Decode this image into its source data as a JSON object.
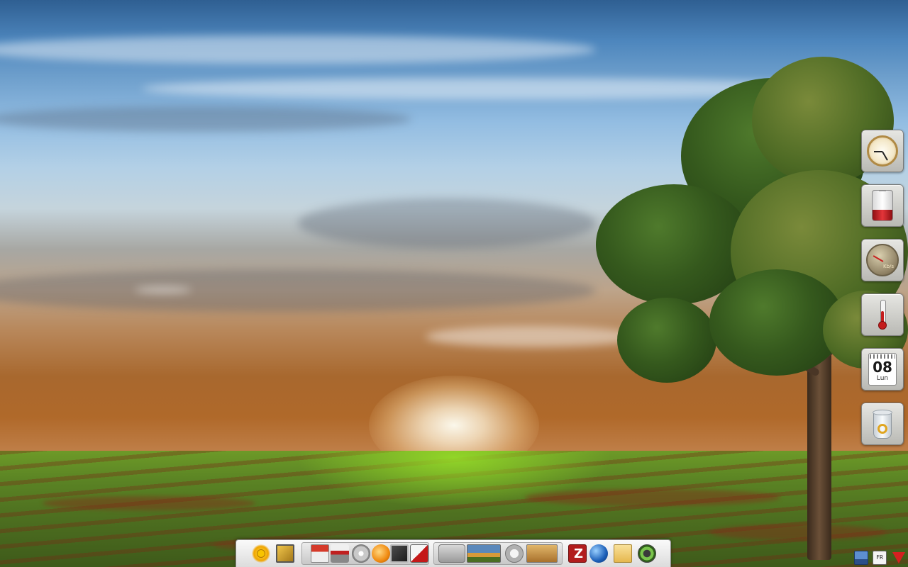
{
  "desktop": {
    "wallpaper": "sunset-field-tree"
  },
  "widgets": {
    "clock": {
      "icon": "clock-icon"
    },
    "battery": {
      "icon": "battery-icon",
      "level": 0.35,
      "color": "#c41d1d"
    },
    "network_monitor": {
      "icon": "gauge-icon",
      "unit": "Kb/s"
    },
    "temperature": {
      "icon": "thermometer-icon"
    },
    "calendar": {
      "icon": "calendar-icon",
      "day": "08",
      "weekday": "Lun"
    },
    "trash": {
      "icon": "trash-icon"
    }
  },
  "dock": {
    "groups": [
      {
        "name": "launchers",
        "items": [
          "sun-icon",
          "monitor-icon"
        ]
      },
      {
        "name": "apps",
        "items": [
          "home-folder-icon",
          "printer-icon",
          "disk-icon",
          "orange-app-icon",
          "mail-icon",
          "package-icon"
        ]
      },
      {
        "name": "desktops",
        "items": [
          "desktop-thumb-1",
          "desktop-thumb-2",
          "desktop-thumb-3",
          "desktop-thumb-4"
        ]
      },
      {
        "name": "tasks",
        "items": [
          "filezilla-icon",
          "globe-icon",
          "notes-icon",
          "speaker-icon"
        ]
      }
    ]
  },
  "tray": {
    "items": [
      "network-icon",
      "keyboard-layout-icon",
      "update-arrow-icon"
    ],
    "keyboard_label": "FR"
  }
}
